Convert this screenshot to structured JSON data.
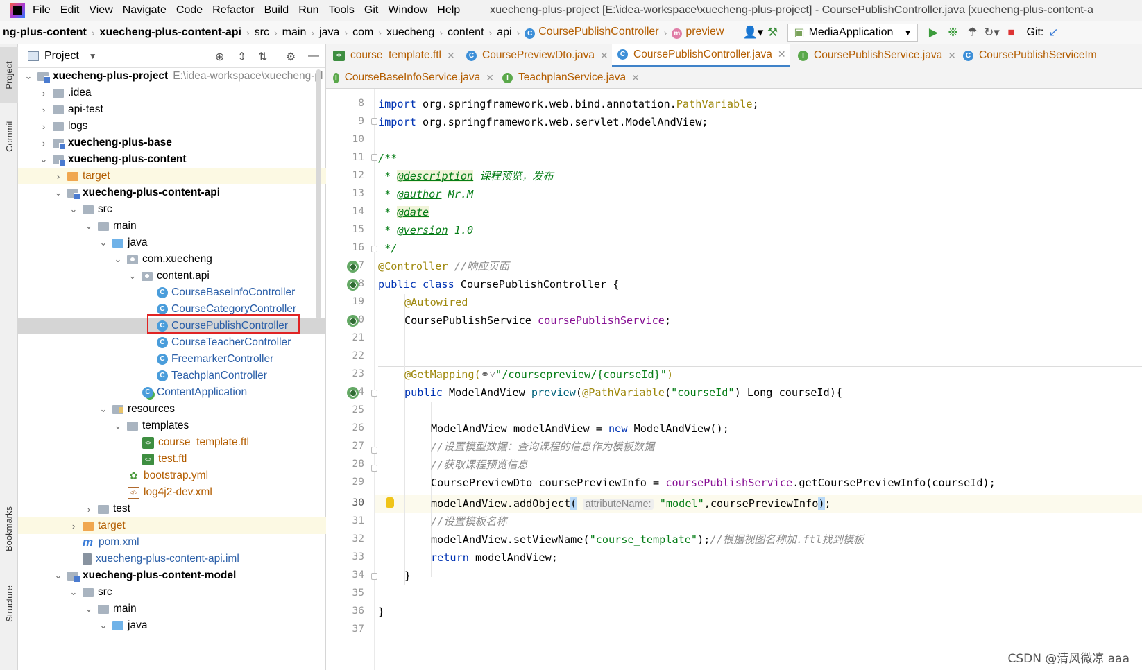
{
  "menubar": {
    "items": [
      "File",
      "Edit",
      "View",
      "Navigate",
      "Code",
      "Refactor",
      "Build",
      "Run",
      "Tools",
      "Git",
      "Window",
      "Help"
    ],
    "title": "xuecheng-plus-project [E:\\idea-workspace\\xuecheng-plus-project] - CoursePublishController.java [xuecheng-plus-content-a"
  },
  "navbar": {
    "crumbs": [
      "ng-plus-content",
      "xuecheng-plus-content-api",
      "src",
      "main",
      "java",
      "com",
      "xuecheng",
      "content",
      "api"
    ],
    "class_crumb": "CoursePublishController",
    "method_crumb": "preview",
    "run_config": "MediaApplication",
    "git_label": "Git:"
  },
  "left_stripe": {
    "project": "Project",
    "commit": "Commit",
    "bookmarks": "Bookmarks",
    "structure": "Structure"
  },
  "project_panel": {
    "title": "Project",
    "tree": [
      {
        "label": "xuecheng-plus-project",
        "suffix": "E:\\idea-workspace\\xuecheng-pl",
        "bold": true
      },
      {
        "label": ".idea"
      },
      {
        "label": "api-test"
      },
      {
        "label": "logs"
      },
      {
        "label": "xuecheng-plus-base",
        "bold": true
      },
      {
        "label": "xuecheng-plus-content",
        "bold": true
      },
      {
        "label": "target"
      },
      {
        "label": "xuecheng-plus-content-api",
        "bold": true
      },
      {
        "label": "src"
      },
      {
        "label": "main"
      },
      {
        "label": "java"
      },
      {
        "label": "com.xuecheng"
      },
      {
        "label": "content.api"
      },
      {
        "label": "CourseBaseInfoController"
      },
      {
        "label": "CourseCategoryController"
      },
      {
        "label": "CoursePublishController"
      },
      {
        "label": "CourseTeacherController"
      },
      {
        "label": "FreemarkerController"
      },
      {
        "label": "TeachplanController"
      },
      {
        "label": "ContentApplication"
      },
      {
        "label": "resources"
      },
      {
        "label": "templates"
      },
      {
        "label": "course_template.ftl"
      },
      {
        "label": "test.ftl"
      },
      {
        "label": "bootstrap.yml"
      },
      {
        "label": "log4j2-dev.xml"
      },
      {
        "label": "test"
      },
      {
        "label": "target"
      },
      {
        "label": "pom.xml"
      },
      {
        "label": "xuecheng-plus-content-api.iml"
      },
      {
        "label": "xuecheng-plus-content-model",
        "bold": true
      },
      {
        "label": "src"
      },
      {
        "label": "main"
      },
      {
        "label": "java"
      }
    ]
  },
  "tabs": {
    "row1": [
      "course_template.ftl",
      "CoursePreviewDto.java",
      "CoursePublishController.java",
      "CoursePublishService.java",
      "CoursePublishServiceIm"
    ],
    "row2": [
      "CourseBaseInfoService.java",
      "TeachplanService.java"
    ],
    "active": "CoursePublishController.java"
  },
  "editor": {
    "line_numbers": [
      "8",
      "9",
      "10",
      "11",
      "12",
      "13",
      "14",
      "15",
      "16",
      "17",
      "18",
      "19",
      "20",
      "21",
      "22",
      "23",
      "24",
      "25",
      "26",
      "27",
      "28",
      "29",
      "30",
      "31",
      "32",
      "33",
      "34",
      "35",
      "36",
      "37"
    ],
    "current_line": "30",
    "code": {
      "l8_kw": "import",
      "l8_a": " org.springframework.web.bind.annotation.",
      "l8_b": "PathVariable",
      "l8_c": ";",
      "l9_kw": "import",
      "l9_a": " org.springframework.web.servlet.ModelAndView;",
      "l11": "/**",
      "l12_star": " * ",
      "l12_tag": "@description",
      "l12_txt": " 课程预览，发布",
      "l13_star": " * ",
      "l13_tag": "@author",
      "l13_txt": " Mr.M",
      "l14_star": " * ",
      "l14_tag": "@date",
      "l15_star": " * ",
      "l15_tag": "@version",
      "l15_txt": " 1.0",
      "l16": " */",
      "l17_an": "@Controller",
      "l17_cm": " //响应页面",
      "l18_kw": "public class",
      "l18_txt": " CoursePublishController {",
      "l19_an": "@Autowired",
      "l20_type": "CoursePublishService ",
      "l20_fld": "coursePublishService",
      "l20_end": ";",
      "l23_an": "@GetMapping(",
      "l23_str_q1": "\"",
      "l23_str": "/coursepreview/{courseId}",
      "l23_str_q2": "\"",
      "l23_end": ")",
      "l24_kw": "public",
      "l24_a": " ModelAndView ",
      "l24_m": "preview",
      "l24_b": "(",
      "l24_an": "@PathVariable",
      "l24_c": "(",
      "l24_s1": "\"",
      "l24_s": "courseId",
      "l24_s2": "\"",
      "l24_d": ") Long courseId){",
      "l26_a": "ModelAndView modelAndView = ",
      "l26_kw": "new",
      "l26_b": " ModelAndView();",
      "l27": "//设置模型数据：查询课程的信息作为模板数据",
      "l28": "//获取课程预览信息",
      "l29_a": "CoursePreviewDto coursePreviewInfo = ",
      "l29_fld": "coursePublishService",
      "l29_b": ".getCoursePreviewInfo(courseId);",
      "l30_a": "modelAndView.addObject",
      "l30_p1": "(",
      "l30_hint": "attributeName:",
      "l30_str": "\"model\"",
      "l30_b": ",coursePreviewInfo",
      "l30_p2": ")",
      "l30_end": ";",
      "l31": "//设置模板名称",
      "l32_a": "modelAndView.setViewName(",
      "l32_s1": "\"",
      "l32_s": "course_template",
      "l32_s2": "\"",
      "l32_b": ");",
      "l32_cm": "//根据视图名称加.ftl找到模板",
      "l33_kw": "return",
      "l33_a": " modelAndView;",
      "l34": "}",
      "l36": "}"
    }
  },
  "watermark": "CSDN @清风微凉 aaa"
}
